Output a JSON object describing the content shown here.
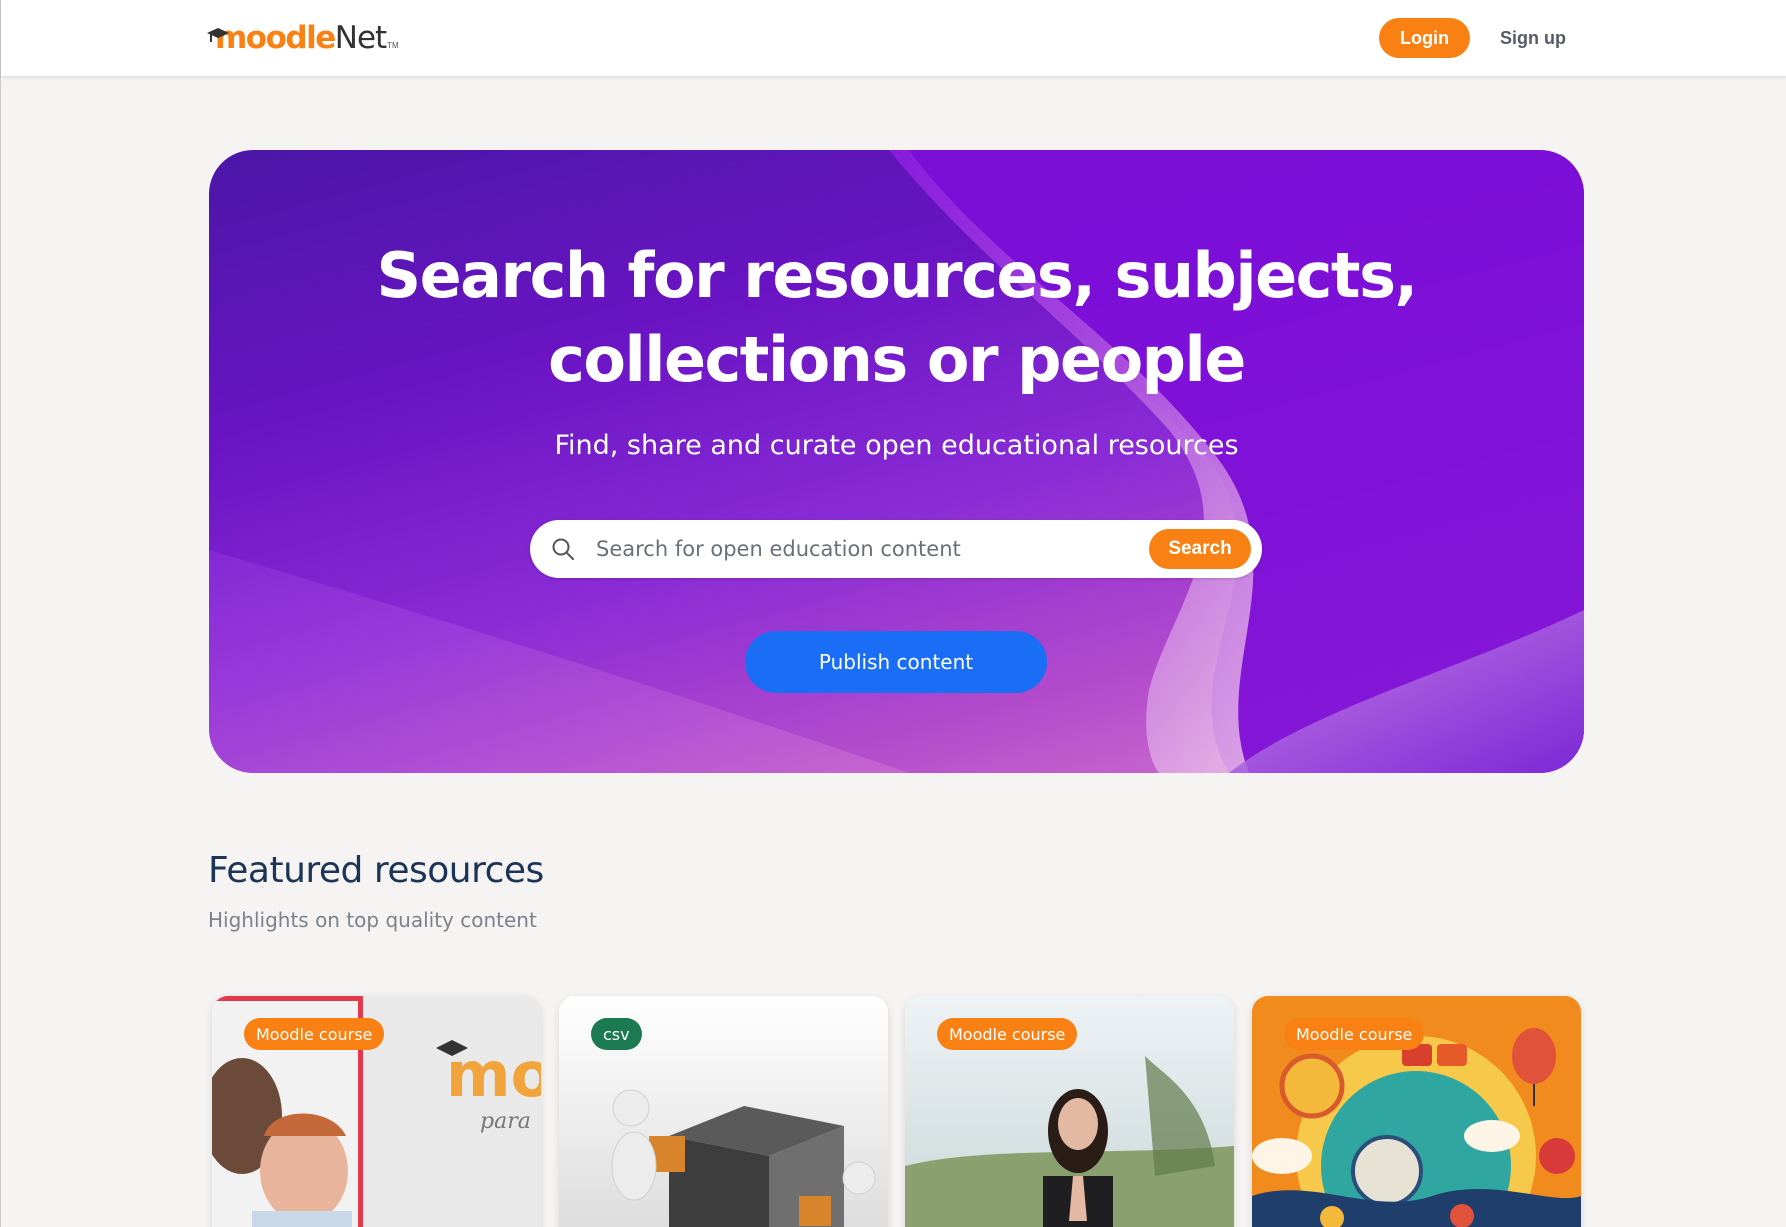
{
  "header": {
    "logo_moodle": "moodle",
    "logo_net": "Net",
    "logo_tm": "TM",
    "login_label": "Login",
    "signup_label": "Sign up"
  },
  "hero": {
    "title_line1": "Search for resources, subjects,",
    "title_line2": "collections or people",
    "subtitle": "Find, share and curate open educational resources",
    "search": {
      "placeholder": "Search for open education content",
      "value": "",
      "button_label": "Search"
    },
    "publish_label": "Publish content"
  },
  "featured": {
    "title": "Featured resources",
    "subtitle": "Highlights on top quality content",
    "cards": [
      {
        "badge": "Moodle course",
        "badge_color": "#f98012",
        "image_icon": "moodle-paradiso-image"
      },
      {
        "badge": "csv",
        "badge_color": "#1b7a52",
        "image_icon": "cube-puzzle-image"
      },
      {
        "badge": "Moodle course",
        "badge_color": "#f98012",
        "image_icon": "meditation-woman-image"
      },
      {
        "badge": "Moodle course",
        "badge_color": "#f98012",
        "image_icon": "colorful-languages-illustration"
      }
    ]
  },
  "colors": {
    "accent_orange": "#f98012",
    "publish_blue": "#1a6ef5",
    "hero_purple": "#6a14c4",
    "heading_navy": "#1c3557"
  }
}
